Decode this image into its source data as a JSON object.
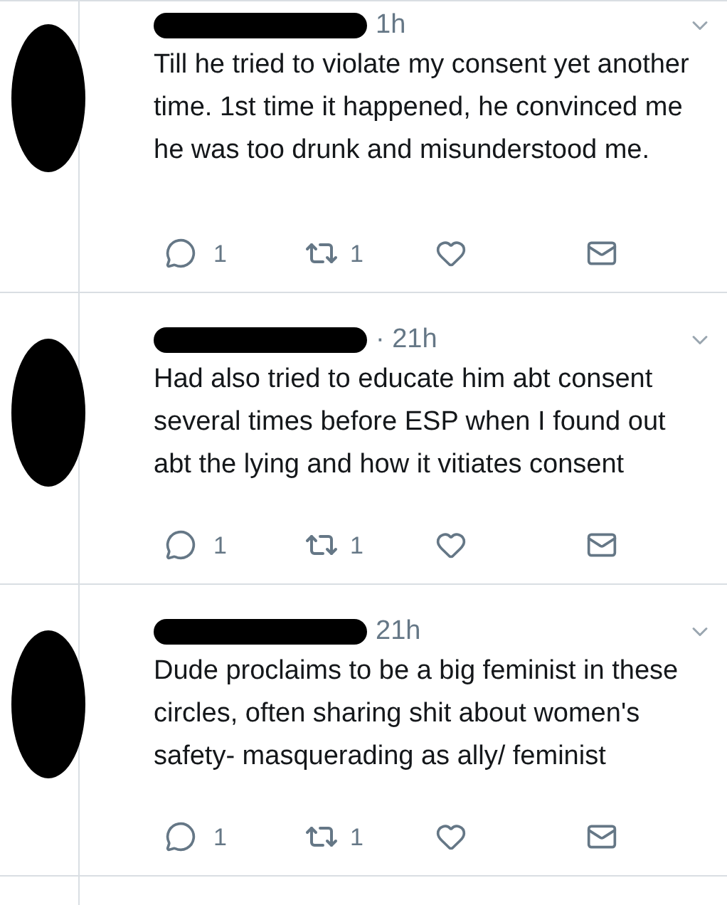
{
  "tweets": [
    {
      "time": "1h",
      "text": "Till he tried to violate my consent yet another time. 1st time it happened, he convinced me he was too drunk and misunderstood me.",
      "replies": "1",
      "retweets": "1"
    },
    {
      "time": "· 21h",
      "text": "Had also tried to educate him abt consent several times before ESP when I found out abt the lying and how it vitiates consent",
      "replies": "1",
      "retweets": "1"
    },
    {
      "time": "21h",
      "text": "Dude proclaims to be a big feminist in these circles, often sharing shit about women's safety- masquerading as ally/ feminist",
      "replies": "1",
      "retweets": "1"
    }
  ]
}
